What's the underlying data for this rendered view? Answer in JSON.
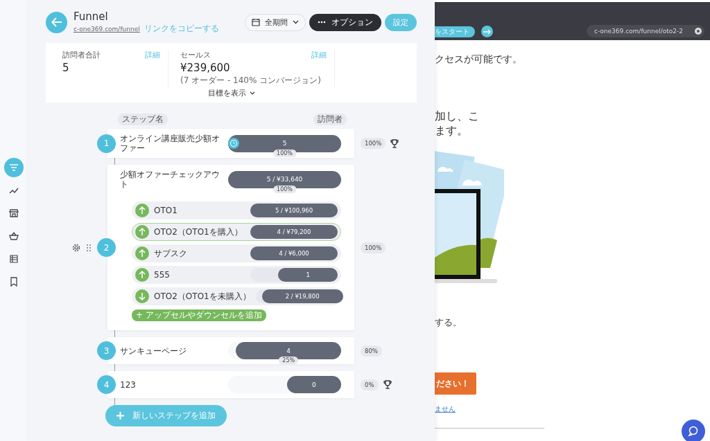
{
  "nav_items": [
    {
      "selected": true
    },
    {
      "selected": false
    },
    {
      "selected": false
    },
    {
      "selected": false
    },
    {
      "selected": false
    },
    {
      "selected": false
    }
  ],
  "header": {
    "title": "Funnel",
    "url": "c-one369.com/funnel",
    "copy_link": "リンクをコピーする",
    "date_range": "全期間",
    "options": "オプション",
    "settings": "設定"
  },
  "stats": {
    "cards": [
      {
        "label": "訪問者合計",
        "detail": "詳細",
        "value": "5"
      },
      {
        "label": "セールス",
        "detail": "詳細",
        "value": "¥239,600",
        "note": "(7 オーダー - 140% コンバージョン)"
      }
    ],
    "show_goals": "目標を表示"
  },
  "columns": {
    "step_name": "ステップ名",
    "visitors": "訪問者"
  },
  "steps": [
    {
      "number": "1",
      "name": "オンライン講座販売少額オファー",
      "value": "5",
      "level": 1,
      "bar_percent": "100%",
      "percent": "100%",
      "timer": true,
      "goal": true,
      "handles": false
    },
    {
      "number": "2",
      "name": "少額オファーチェックアウト",
      "value": "5 / ¥33,640",
      "level": 1,
      "bar_percent": "100%",
      "percent": "100%",
      "timer": false,
      "goal": false,
      "handles": true,
      "add_offer": "+ アップセルやダウンセルを追加",
      "offers": [
        {
          "kind": "upsell",
          "name": "OTO1",
          "value": "5 / ¥100,960",
          "level": 1,
          "selected": false
        },
        {
          "kind": "upsell",
          "name": "OTO2（OTO1を購入）",
          "value": "4 / ¥79,200",
          "level": 1,
          "selected": true
        },
        {
          "kind": "upsell",
          "name": "サブスク",
          "value": "4 / ¥6,000",
          "level": 1,
          "selected": false
        },
        {
          "kind": "upsell",
          "name": "555",
          "value": "1",
          "level": 0.68,
          "selected": false
        },
        {
          "kind": "downsell",
          "name": "OTO2（OTO1を未購入）",
          "value": "2 / ¥19,800",
          "level": 0.93,
          "selected": false
        }
      ]
    },
    {
      "number": "3",
      "name": "サンキューページ",
      "value": "4",
      "level": 0.93,
      "bar_percent": "25%",
      "percent": "80%",
      "timer": false,
      "goal": false,
      "handles": false
    },
    {
      "number": "4",
      "name": "123",
      "value": "0",
      "level": 0.48,
      "percent": "0%",
      "timer": false,
      "goal": true,
      "handles": false
    }
  ],
  "add_step": "新しいステップを追加",
  "preview": {
    "start_button": "をスタート",
    "url": "c-one369.com/funnel/oto2-2",
    "access_text": "クセスが可能です。",
    "heading_lines": [
      "加し、こ",
      "ます。"
    ],
    "body_text": "する。",
    "cta_button": "ださい！",
    "decline_link": "ません"
  }
}
